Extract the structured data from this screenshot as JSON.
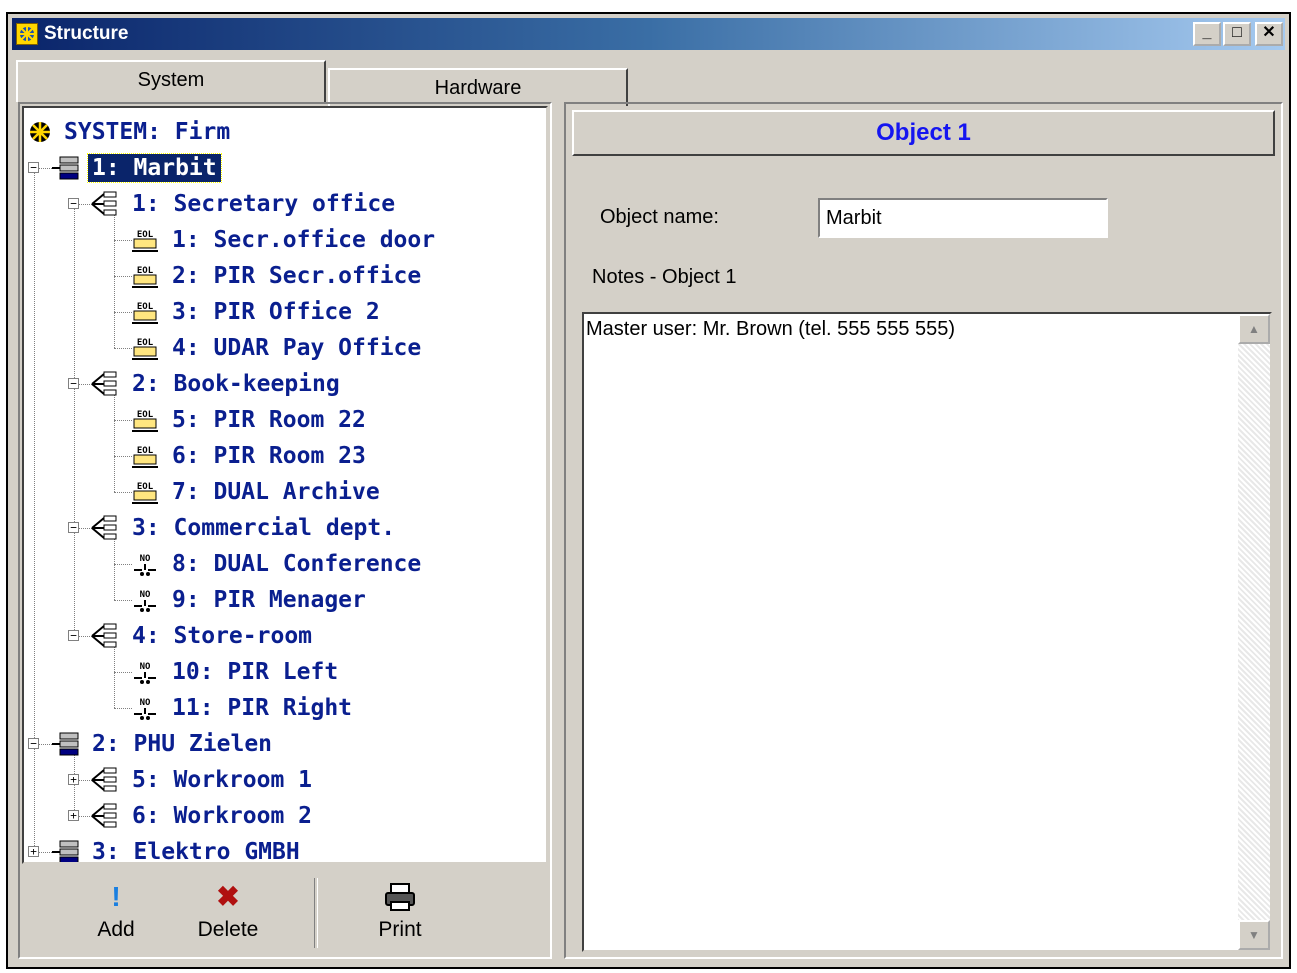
{
  "window": {
    "title": "Structure",
    "controls": {
      "minimize": "_",
      "maximize": "□",
      "close": "✕"
    }
  },
  "tabs": [
    {
      "label": "System",
      "active": true
    },
    {
      "label": "Hardware",
      "active": false
    }
  ],
  "tree": {
    "root": "SYSTEM: Firm",
    "nodes": [
      {
        "label": "1: Marbit",
        "type": "object",
        "expander": "minus",
        "selected": true
      },
      {
        "label": "1: Secretary office",
        "type": "partition",
        "expander": "minus"
      },
      {
        "label": "1: Secr.office door",
        "type": "zone-eol"
      },
      {
        "label": "2: PIR Secr.office",
        "type": "zone-eol"
      },
      {
        "label": "3: PIR Office 2",
        "type": "zone-eol"
      },
      {
        "label": "4: UDAR Pay Office",
        "type": "zone-eol"
      },
      {
        "label": "2: Book-keeping",
        "type": "partition",
        "expander": "minus"
      },
      {
        "label": "5: PIR Room 22",
        "type": "zone-eol"
      },
      {
        "label": "6: PIR Room 23",
        "type": "zone-eol"
      },
      {
        "label": "7: DUAL Archive",
        "type": "zone-eol"
      },
      {
        "label": "3: Commercial dept.",
        "type": "partition",
        "expander": "minus"
      },
      {
        "label": "8: DUAL Conference",
        "type": "zone-no"
      },
      {
        "label": "9: PIR Menager",
        "type": "zone-no"
      },
      {
        "label": "4: Store-room",
        "type": "partition",
        "expander": "minus"
      },
      {
        "label": "10: PIR Left",
        "type": "zone-no"
      },
      {
        "label": "11: PIR Right",
        "type": "zone-no"
      },
      {
        "label": "2: PHU Zielen",
        "type": "object",
        "expander": "minus"
      },
      {
        "label": "5: Workroom 1",
        "type": "partition",
        "expander": "plus"
      },
      {
        "label": "6: Workroom 2",
        "type": "partition",
        "expander": "plus"
      },
      {
        "label": "3: Elektro GMBH",
        "type": "object",
        "expander": "plus"
      }
    ],
    "icon_texts": {
      "eol": "EOL",
      "no": "NO"
    }
  },
  "toolbar": {
    "add": {
      "label": "Add",
      "icon": "!"
    },
    "delete": {
      "label": "Delete",
      "icon": "✖"
    },
    "print": {
      "label": "Print",
      "icon": "printer-icon"
    }
  },
  "details": {
    "header": "Object 1",
    "name_label": "Object name:",
    "name_value": "Marbit",
    "notes_label": "Notes - Object 1",
    "notes_text": "Master user: Mr. Brown (tel. 555 555 555)"
  },
  "colors": {
    "tree_text": "#0a1f8f",
    "header_text": "#1515f0",
    "selection": "#0a246a",
    "delete_icon": "#b01010",
    "add_icon": "#1a7fe0"
  }
}
